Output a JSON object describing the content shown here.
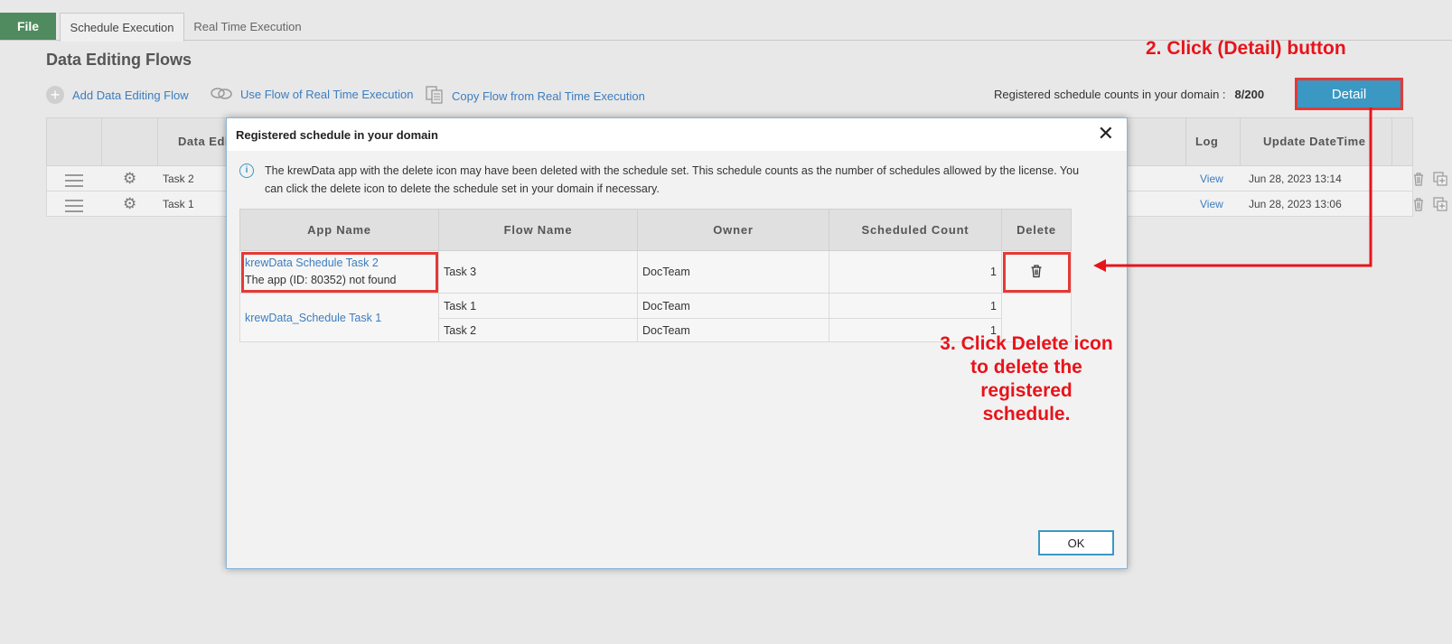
{
  "tabs": {
    "file": "File",
    "schedule": "Schedule Execution",
    "realtime": "Real Time Execution"
  },
  "page_title": "Data Editing Flows",
  "toolbar": {
    "add": "Add Data Editing Flow",
    "use": "Use Flow of Real Time Execution",
    "copy": "Copy Flow from Real Time Execution"
  },
  "schedule_count": {
    "label": "Registered schedule counts in your domain :",
    "value": "8/200",
    "detail_button": "Detail"
  },
  "annotations": {
    "step2": "2. Click (Detail) button",
    "step3": "3. Click Delete icon to delete the registered schedule."
  },
  "background_table": {
    "headers": {
      "name": "Data Edi",
      "log": "Log",
      "update": "Update DateTime"
    },
    "rows": [
      {
        "name": "Task 2",
        "log": "View",
        "update": "Jun 28, 2023 13:14"
      },
      {
        "name": "Task 1",
        "log": "View",
        "update": "Jun 28, 2023 13:06"
      }
    ]
  },
  "modal": {
    "title": "Registered schedule in your domain",
    "info": "The krewData app with the delete icon may have been deleted with the schedule set. This schedule counts as the number of schedules allowed by the license. You can click the delete icon to delete the schedule set in your domain if necessary.",
    "columns": [
      "App Name",
      "Flow Name",
      "Owner",
      "Scheduled Count",
      "Delete"
    ],
    "groups": [
      {
        "app_name": "krewData Schedule Task 2",
        "app_note": "The app (ID: 80352) not found",
        "flows": [
          {
            "flow": "Task 3",
            "owner": "DocTeam",
            "count": "1"
          }
        ]
      },
      {
        "app_name": "krewData_Schedule Task 1",
        "flows": [
          {
            "flow": "Task 1",
            "owner": "DocTeam",
            "count": "1"
          },
          {
            "flow": "Task 2",
            "owner": "DocTeam",
            "count": "1"
          }
        ]
      }
    ],
    "ok_button": "OK"
  },
  "colors": {
    "accent": "#3a98c3",
    "file_tab": "#4f8b5e",
    "annotation": "#e8131a",
    "link": "#3c7dbf"
  }
}
